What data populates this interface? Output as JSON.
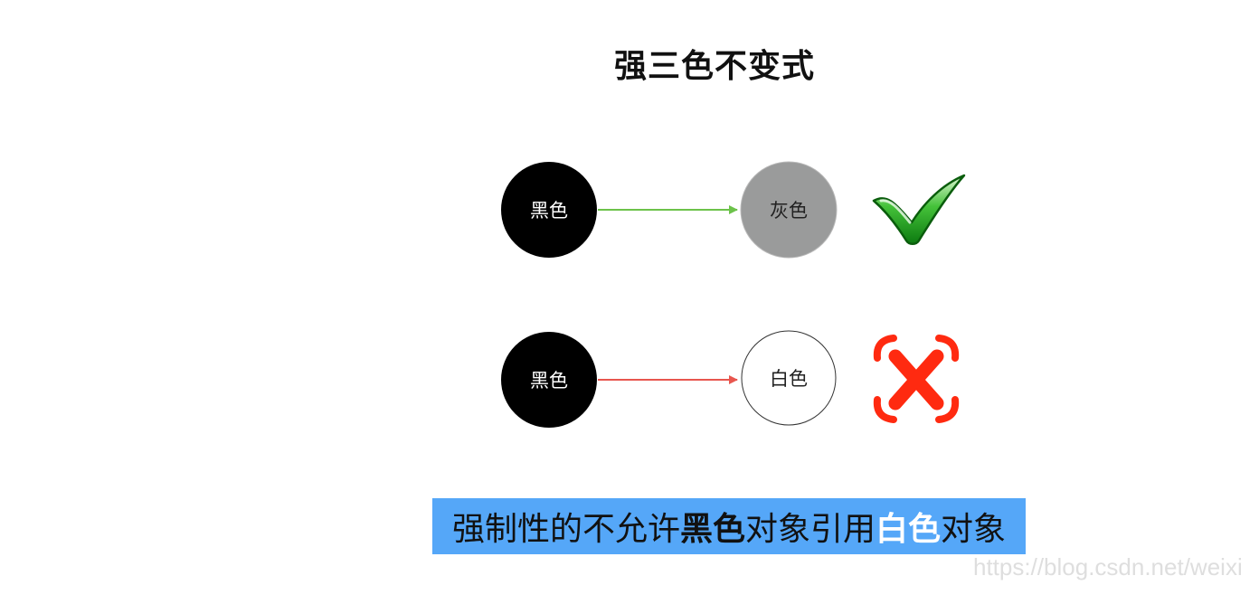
{
  "title": "强三色不变式",
  "rows": [
    {
      "from": "黑色",
      "to": "灰色",
      "result": "allowed",
      "arrow_color": "#6cc24a"
    },
    {
      "from": "黑色",
      "to": "白色",
      "result": "forbidden",
      "arrow_color": "#e8564e"
    }
  ],
  "caption": {
    "part1": "强制性的不允许",
    "black": "黑色",
    "part2": "对象引用",
    "white": "白色",
    "part3": "对象"
  },
  "colors": {
    "black_node": "#000000",
    "gray_node": "#9a9b9b",
    "white_node": "#ffffff",
    "caption_bg": "#55a7f8",
    "check": "#1fa31f",
    "cross": "#ff2a10"
  },
  "icons": {
    "ok": "check-icon",
    "bad": "cross-icon"
  },
  "watermark": "https://blog.csdn.net/weixi"
}
